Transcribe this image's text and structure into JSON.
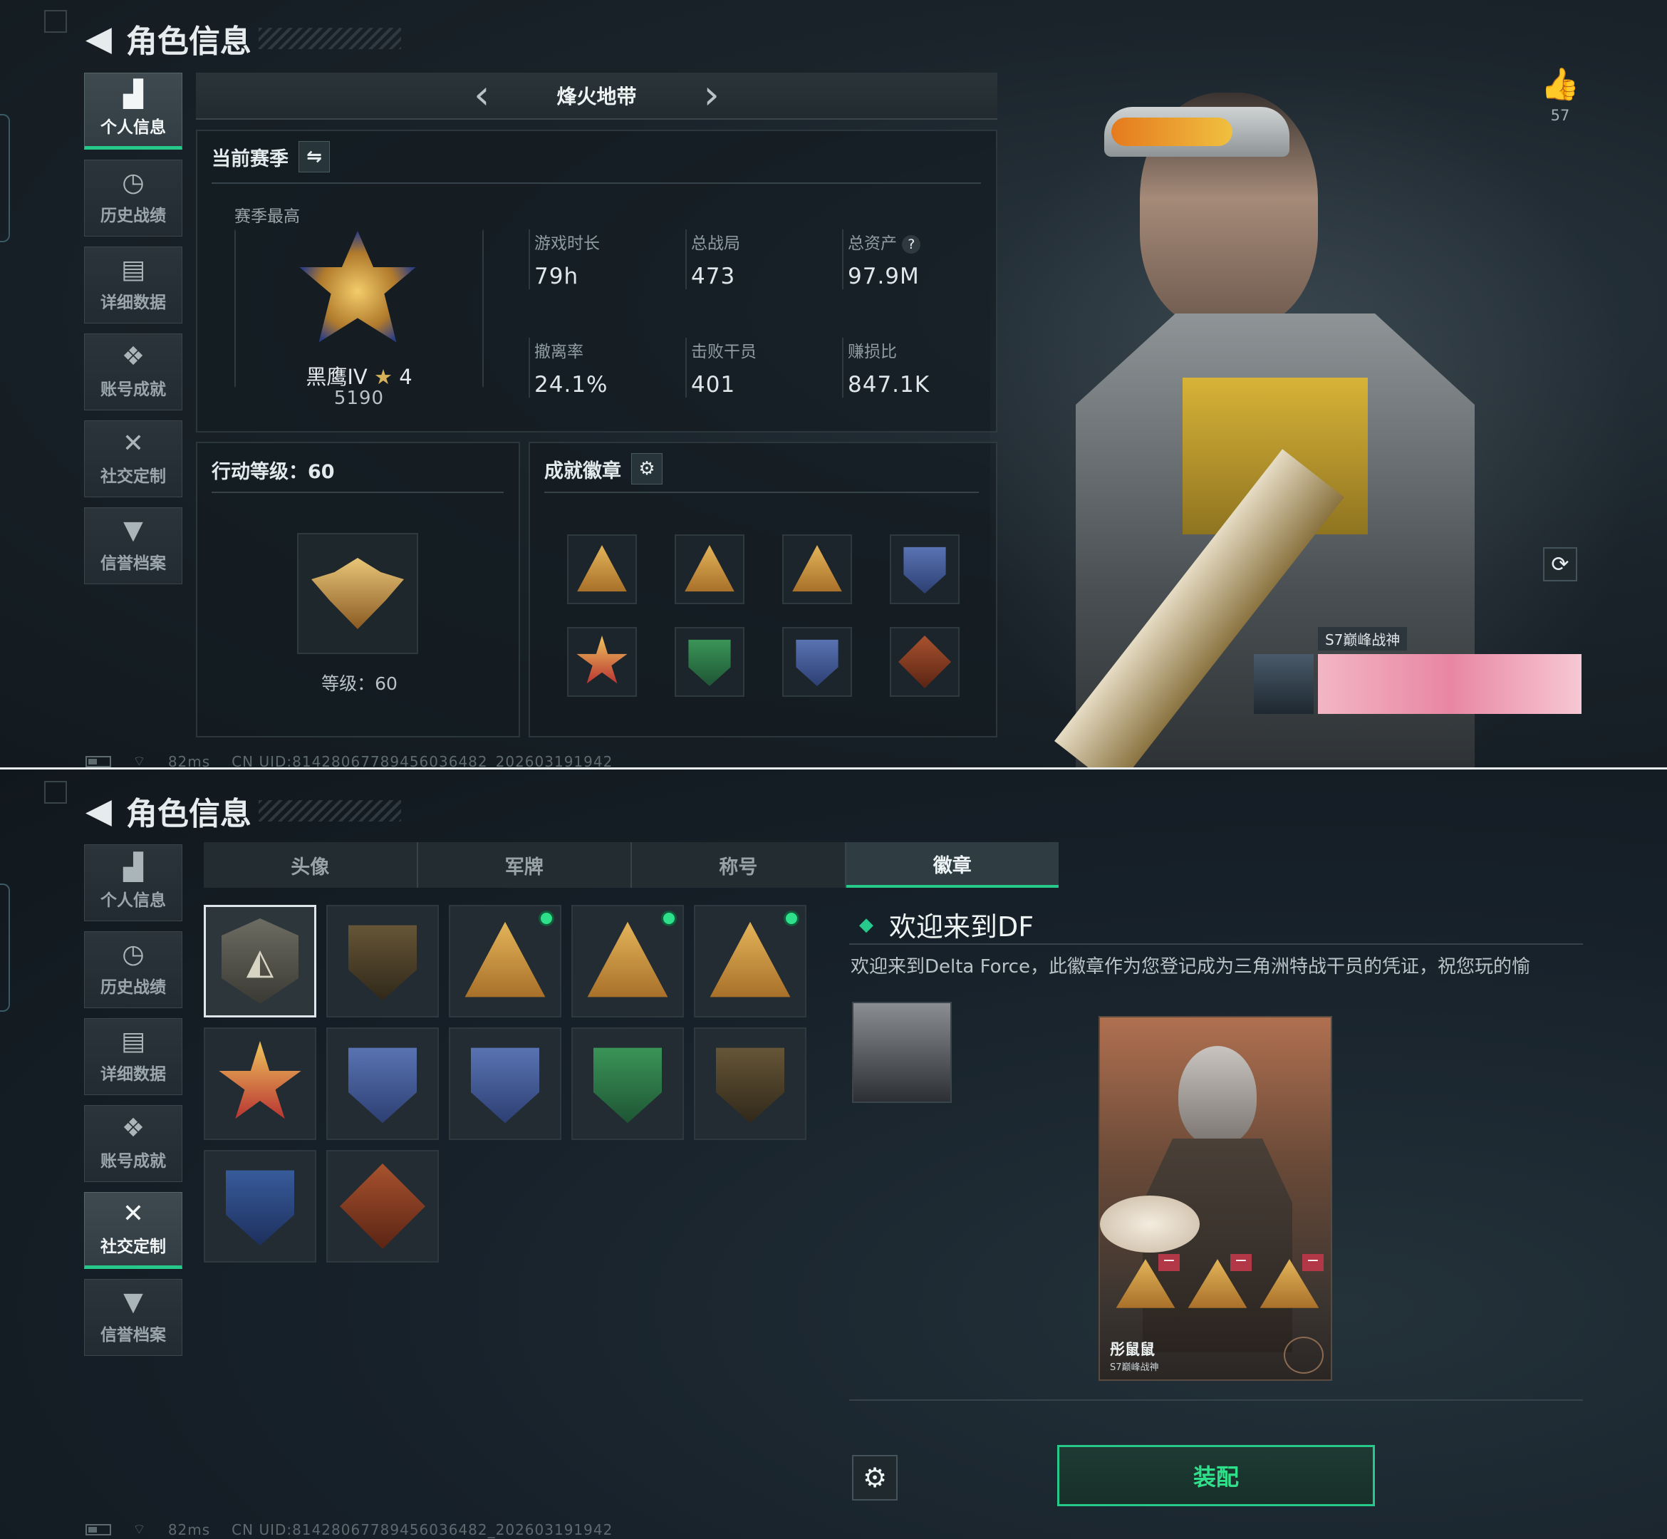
{
  "screen1": {
    "back_title": "角色信息",
    "sidebar": [
      {
        "icon": "bar-chart-icon",
        "glyph": "▟",
        "label": "个人信息",
        "active": true
      },
      {
        "icon": "clock-history-icon",
        "glyph": "◷",
        "label": "历史战绩",
        "active": false
      },
      {
        "icon": "folder-icon",
        "glyph": "▤",
        "label": "详细数据",
        "active": false
      },
      {
        "icon": "achievement-icon",
        "glyph": "❖",
        "label": "账号成就",
        "active": false
      },
      {
        "icon": "tools-icon",
        "glyph": "✕",
        "label": "社交定制",
        "active": false
      },
      {
        "icon": "credit-icon",
        "glyph": "▼",
        "label": "信誉档案",
        "active": false
      }
    ],
    "mode": {
      "title": "烽火地带",
      "prev_glyph": "‹",
      "next_glyph": "›"
    },
    "season": {
      "title": "当前赛季",
      "switch_glyph": "⇋",
      "best_label": "赛季最高",
      "rank_name": "黑鹰IV",
      "rank_star": "★",
      "rank_star_count": "4",
      "rank_score": "5190",
      "stats": [
        {
          "label": "游戏时长",
          "value": "79h"
        },
        {
          "label": "总战局",
          "value": "473"
        },
        {
          "label": "总资产",
          "value": "97.9M",
          "help": "?"
        },
        {
          "label": "撤离率",
          "value": "24.1%"
        },
        {
          "label": "击败干员",
          "value": "401"
        },
        {
          "label": "赚损比",
          "value": "847.1K"
        }
      ]
    },
    "action_level": {
      "title": "行动等级：60",
      "level_text": "等级：60"
    },
    "achievements": {
      "title": "成就徽章",
      "settings_glyph": "⚙"
    },
    "likes": {
      "glyph": "👍",
      "count": "57"
    },
    "refresh_glyph": "⟳",
    "card_caption": "S7巅峰战神",
    "status_bar": {
      "ping": "82ms",
      "uid": "CN UID:8142806778945603648​2_202603191942"
    }
  },
  "screen2": {
    "back_title": "角色信息",
    "sidebar": [
      {
        "icon": "bar-chart-icon",
        "glyph": "▟",
        "label": "个人信息",
        "active": false
      },
      {
        "icon": "clock-history-icon",
        "glyph": "◷",
        "label": "历史战绩",
        "active": false
      },
      {
        "icon": "folder-icon",
        "glyph": "▤",
        "label": "详细数据",
        "active": false
      },
      {
        "icon": "achievement-icon",
        "glyph": "❖",
        "label": "账号成就",
        "active": false
      },
      {
        "icon": "tools-icon",
        "glyph": "✕",
        "label": "社交定制",
        "active": true
      },
      {
        "icon": "credit-icon",
        "glyph": "▼",
        "label": "信誉档案",
        "active": false
      }
    ],
    "tabs": [
      {
        "label": "头像",
        "active": false
      },
      {
        "label": "军牌",
        "active": false
      },
      {
        "label": "称号",
        "active": false
      },
      {
        "label": "徽章",
        "active": true
      }
    ],
    "badge_detail": {
      "title": "欢迎来到DF",
      "description": "欢迎来到Delta Force，此徽章作为您登记成为三角洲特战干员的凭证，祝您玩的愉",
      "card_name": "彤鼠鼠",
      "card_subtitle": "S7巅峰战神"
    },
    "equip_button": "装配",
    "settings_glyph": "⚙",
    "status_bar": {
      "ping": "82ms",
      "uid": "CN UID:81428067789456036482_202603191942"
    }
  },
  "colors": {
    "accent": "#27c98a",
    "background": "#141b20",
    "panel_border": "#2c373d"
  }
}
